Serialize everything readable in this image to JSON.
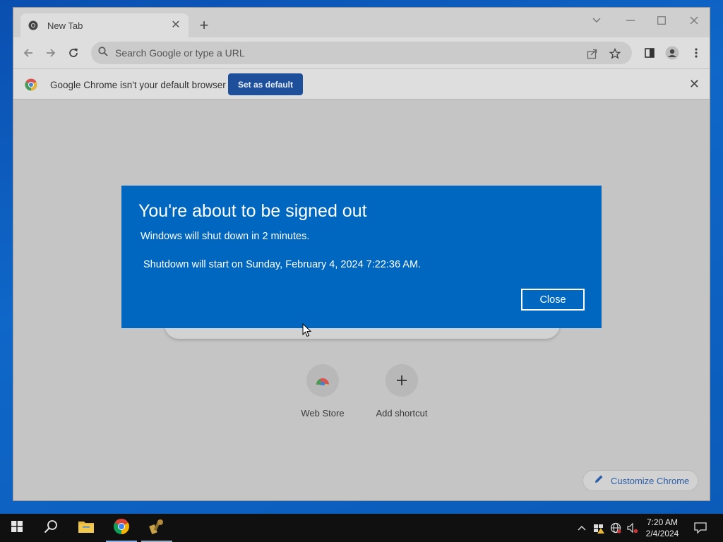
{
  "browser": {
    "tab": {
      "title": "New Tab"
    },
    "omnibox": {
      "placeholder": "Search Google or type a URL"
    },
    "infobar": {
      "text": "Google Chrome isn't your default browser",
      "button": "Set as default"
    },
    "shortcuts": [
      {
        "label": "Web Store",
        "icon": "web-store-icon"
      },
      {
        "label": "Add shortcut",
        "icon": "plus-icon"
      }
    ],
    "customize_label": "Customize Chrome"
  },
  "dialog": {
    "title": "You're about to be signed out",
    "line1": "Windows will shut down in 2 minutes.",
    "line2": "Shutdown will start on Sunday, February 4, 2024 7:22:36 AM.",
    "close_label": "Close",
    "background": "#0067c0"
  },
  "taskbar": {
    "apps": [
      "start-icon",
      "search-icon",
      "file-explorer-icon",
      "chrome-icon",
      "tool-app-icon"
    ],
    "clock": {
      "time": "7:20 AM",
      "date": "2/4/2024"
    }
  }
}
